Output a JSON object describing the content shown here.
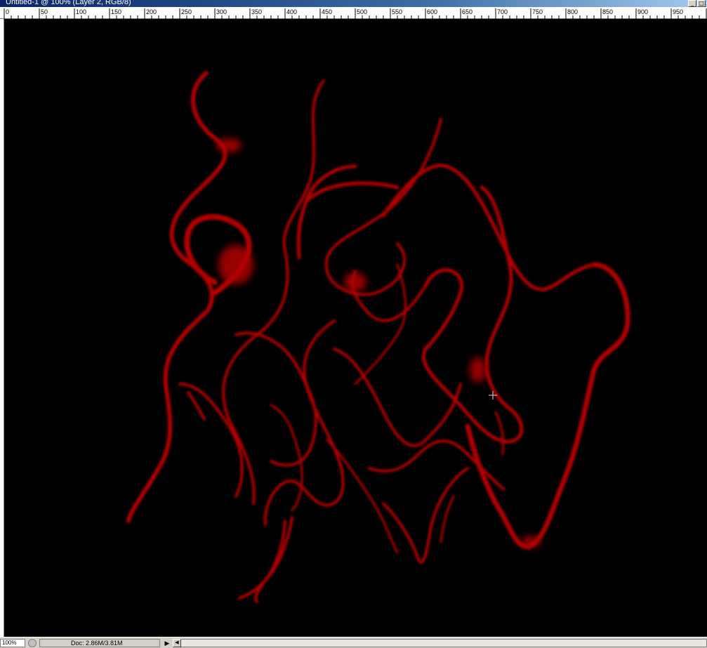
{
  "window": {
    "title": "Untitled-1 @ 100% (Layer 2, RGB/8)",
    "minimize_glyph": "_",
    "maximize_glyph": "□"
  },
  "ruler": {
    "ticks": [
      "0",
      "50",
      "100",
      "150",
      "200",
      "250",
      "300",
      "350",
      "400",
      "450",
      "500",
      "550",
      "600",
      "650",
      "700",
      "750",
      "800",
      "850",
      "900",
      "950"
    ]
  },
  "canvas": {
    "background": "#000000",
    "stroke_color": "#b00000",
    "cursor_icon": "crosshair-icon"
  },
  "status": {
    "zoom": "100%",
    "doc_info": "Doc: 2.86M/3.81M",
    "menu_arrow": "▶",
    "scroll_left_glyph": "◀"
  }
}
